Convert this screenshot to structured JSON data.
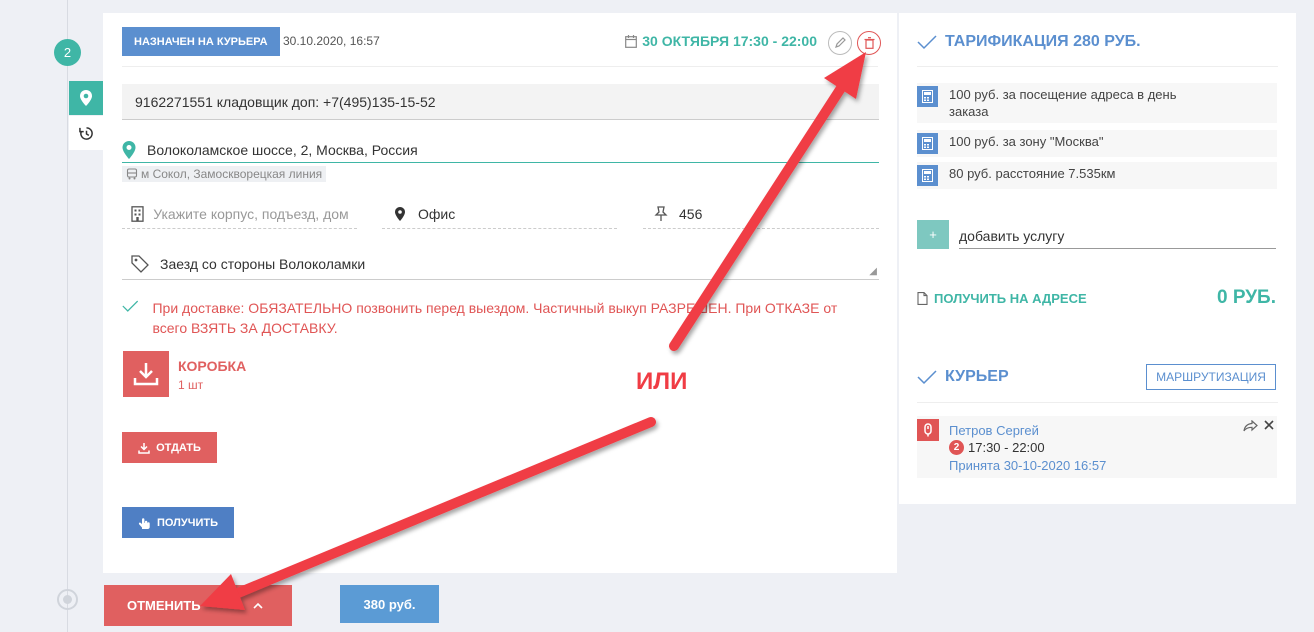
{
  "timeline": {
    "step_number": "2"
  },
  "order": {
    "status_label": "НАЗНАЧЕН НА КУРЬЕРА",
    "status_date": "30.10.2020, 16:57",
    "delivery_window": "30 ОКТЯБРЯ 17:30 - 22:00",
    "contact": "9162271551 кладовщик доп: +7(495)135-15-52",
    "address": "Волоколамское шоссе, 2, Москва, Россия",
    "metro": "м Сокол, Замоскворецкая линия",
    "building_placeholder": "Укажите корпус, подъезд, дом",
    "office": "Офис",
    "room": "456",
    "comment": "Заезд со стороны Волоколамки",
    "delivery_note": "При доставке: ОБЯЗАТЕЛЬНО позвонить перед выездом. Частичный выкуп РАЗРЕШЕН. При ОТКАЗЕ от всего ВЗЯТЬ ЗА ДОСТАВКУ.",
    "item": {
      "name": "КОРОБКА",
      "qty": "1 шт"
    },
    "give_label": "ОТДАТЬ",
    "receive_label": "ПОЛУЧИТЬ"
  },
  "footer": {
    "cancel_label": "ОТМЕНИТЬ",
    "price_label": "380 руб."
  },
  "tariff": {
    "title": "ТАРИФИКАЦИЯ 280 РУБ.",
    "rows": [
      "100 руб. за посещение адреса в день заказа",
      "100 руб. за зону \"Москва\"",
      "80 руб. расстояние 7.535км"
    ],
    "add_service_button": "+",
    "add_service_label": "добавить услугу",
    "pay_on_address_label": "ПОЛУЧИТЬ НА АДРЕСЕ",
    "pay_on_address_amount": "0 РУБ."
  },
  "courier": {
    "title": "КУРЬЕР",
    "routing_label": "МАРШРУТИЗАЦИЯ",
    "name": "Петров Сергей",
    "route_number": "2",
    "slot": "17:30 - 22:00",
    "accepted": "Принята 30-10-2020 16:57"
  },
  "annotation": {
    "or_label": "ИЛИ",
    "arrow_color": "#f03c44"
  },
  "colors": {
    "teal": "#3fb6a6",
    "blue": "#5b8fcf",
    "red": "#e06060"
  }
}
